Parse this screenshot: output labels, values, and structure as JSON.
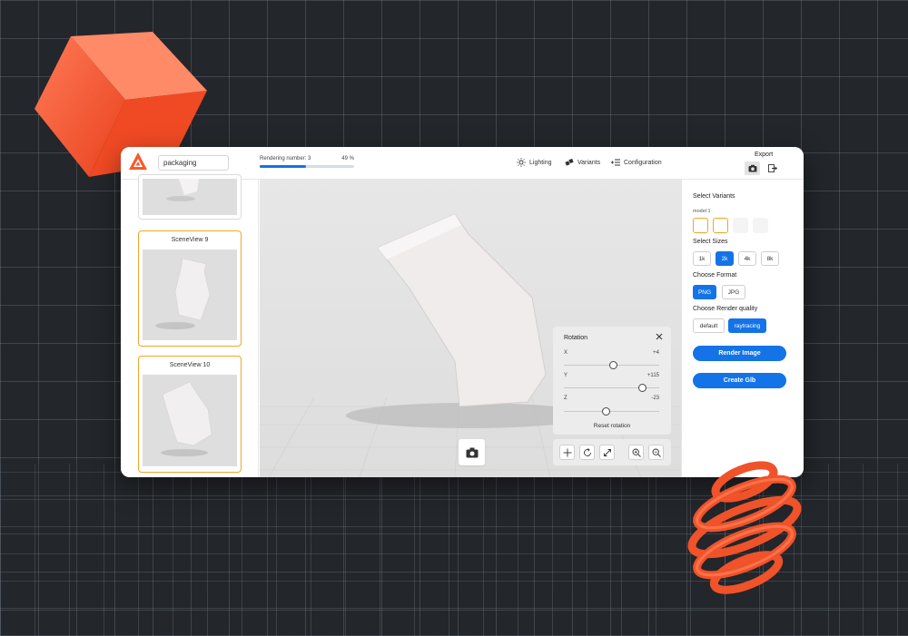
{
  "app": {
    "project_name": "packaging",
    "rendering_label": "Rendering number: 3",
    "rendering_percent_label": "49 %",
    "progress": 0.49
  },
  "nav": {
    "lighting": "Lighting",
    "variants": "Variants",
    "configuration": "Configuration",
    "export_label": "Export"
  },
  "sidebar": {
    "cards": [
      {
        "title": ""
      },
      {
        "title": "SceneView 9"
      },
      {
        "title": "SceneView 10"
      }
    ]
  },
  "rotation": {
    "title": "Rotation",
    "axes": [
      {
        "label": "X",
        "value": "+4",
        "position": 0.51
      },
      {
        "label": "Y",
        "value": "+115",
        "position": 0.82
      },
      {
        "label": "Z",
        "value": "-23",
        "position": 0.44
      }
    ],
    "reset_label": "Reset rotation"
  },
  "panel": {
    "select_variants": "Select Variants",
    "model_label": "model 1",
    "select_sizes": "Select Sizes",
    "sizes": [
      "1k",
      "2k",
      "4k",
      "8k"
    ],
    "selected_size": "2k",
    "choose_format": "Choose Format",
    "formats": [
      "PNG",
      "JPG"
    ],
    "selected_format": "PNG",
    "choose_quality": "Choose Render quality",
    "qualities": [
      "default",
      "raytracing"
    ],
    "selected_quality": "raytracing",
    "render_button": "Render Image",
    "glb_button": "Create Glb"
  },
  "colors": {
    "accent": "#1473e6",
    "card_border": "#f0a524",
    "brand": "#fa5a2a"
  },
  "icons": [
    "sun-icon",
    "variants-icon",
    "sliders-icon",
    "camera-icon",
    "export-icon",
    "close-icon",
    "move-icon",
    "rotate-icon",
    "expand-icon",
    "zoom-in-icon",
    "zoom-out-icon"
  ]
}
